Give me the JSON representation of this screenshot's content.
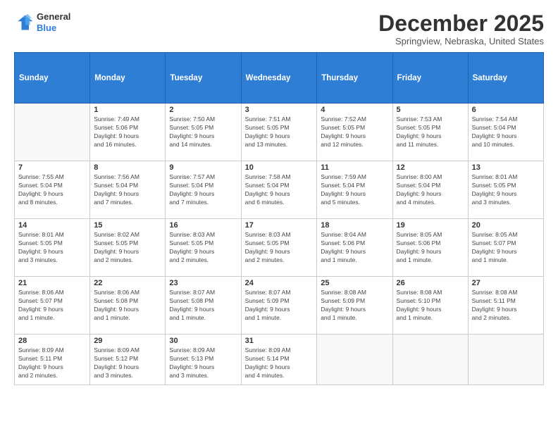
{
  "logo": {
    "line1": "General",
    "line2": "Blue"
  },
  "title": "December 2025",
  "subtitle": "Springview, Nebraska, United States",
  "days_of_week": [
    "Sunday",
    "Monday",
    "Tuesday",
    "Wednesday",
    "Thursday",
    "Friday",
    "Saturday"
  ],
  "weeks": [
    [
      {
        "day": "",
        "info": ""
      },
      {
        "day": "1",
        "info": "Sunrise: 7:49 AM\nSunset: 5:06 PM\nDaylight: 9 hours\nand 16 minutes."
      },
      {
        "day": "2",
        "info": "Sunrise: 7:50 AM\nSunset: 5:05 PM\nDaylight: 9 hours\nand 14 minutes."
      },
      {
        "day": "3",
        "info": "Sunrise: 7:51 AM\nSunset: 5:05 PM\nDaylight: 9 hours\nand 13 minutes."
      },
      {
        "day": "4",
        "info": "Sunrise: 7:52 AM\nSunset: 5:05 PM\nDaylight: 9 hours\nand 12 minutes."
      },
      {
        "day": "5",
        "info": "Sunrise: 7:53 AM\nSunset: 5:05 PM\nDaylight: 9 hours\nand 11 minutes."
      },
      {
        "day": "6",
        "info": "Sunrise: 7:54 AM\nSunset: 5:04 PM\nDaylight: 9 hours\nand 10 minutes."
      }
    ],
    [
      {
        "day": "7",
        "info": "Sunrise: 7:55 AM\nSunset: 5:04 PM\nDaylight: 9 hours\nand 8 minutes."
      },
      {
        "day": "8",
        "info": "Sunrise: 7:56 AM\nSunset: 5:04 PM\nDaylight: 9 hours\nand 7 minutes."
      },
      {
        "day": "9",
        "info": "Sunrise: 7:57 AM\nSunset: 5:04 PM\nDaylight: 9 hours\nand 7 minutes."
      },
      {
        "day": "10",
        "info": "Sunrise: 7:58 AM\nSunset: 5:04 PM\nDaylight: 9 hours\nand 6 minutes."
      },
      {
        "day": "11",
        "info": "Sunrise: 7:59 AM\nSunset: 5:04 PM\nDaylight: 9 hours\nand 5 minutes."
      },
      {
        "day": "12",
        "info": "Sunrise: 8:00 AM\nSunset: 5:04 PM\nDaylight: 9 hours\nand 4 minutes."
      },
      {
        "day": "13",
        "info": "Sunrise: 8:01 AM\nSunset: 5:05 PM\nDaylight: 9 hours\nand 3 minutes."
      }
    ],
    [
      {
        "day": "14",
        "info": "Sunrise: 8:01 AM\nSunset: 5:05 PM\nDaylight: 9 hours\nand 3 minutes."
      },
      {
        "day": "15",
        "info": "Sunrise: 8:02 AM\nSunset: 5:05 PM\nDaylight: 9 hours\nand 2 minutes."
      },
      {
        "day": "16",
        "info": "Sunrise: 8:03 AM\nSunset: 5:05 PM\nDaylight: 9 hours\nand 2 minutes."
      },
      {
        "day": "17",
        "info": "Sunrise: 8:03 AM\nSunset: 5:05 PM\nDaylight: 9 hours\nand 2 minutes."
      },
      {
        "day": "18",
        "info": "Sunrise: 8:04 AM\nSunset: 5:06 PM\nDaylight: 9 hours\nand 1 minute."
      },
      {
        "day": "19",
        "info": "Sunrise: 8:05 AM\nSunset: 5:06 PM\nDaylight: 9 hours\nand 1 minute."
      },
      {
        "day": "20",
        "info": "Sunrise: 8:05 AM\nSunset: 5:07 PM\nDaylight: 9 hours\nand 1 minute."
      }
    ],
    [
      {
        "day": "21",
        "info": "Sunrise: 8:06 AM\nSunset: 5:07 PM\nDaylight: 9 hours\nand 1 minute."
      },
      {
        "day": "22",
        "info": "Sunrise: 8:06 AM\nSunset: 5:08 PM\nDaylight: 9 hours\nand 1 minute."
      },
      {
        "day": "23",
        "info": "Sunrise: 8:07 AM\nSunset: 5:08 PM\nDaylight: 9 hours\nand 1 minute."
      },
      {
        "day": "24",
        "info": "Sunrise: 8:07 AM\nSunset: 5:09 PM\nDaylight: 9 hours\nand 1 minute."
      },
      {
        "day": "25",
        "info": "Sunrise: 8:08 AM\nSunset: 5:09 PM\nDaylight: 9 hours\nand 1 minute."
      },
      {
        "day": "26",
        "info": "Sunrise: 8:08 AM\nSunset: 5:10 PM\nDaylight: 9 hours\nand 1 minute."
      },
      {
        "day": "27",
        "info": "Sunrise: 8:08 AM\nSunset: 5:11 PM\nDaylight: 9 hours\nand 2 minutes."
      }
    ],
    [
      {
        "day": "28",
        "info": "Sunrise: 8:09 AM\nSunset: 5:11 PM\nDaylight: 9 hours\nand 2 minutes."
      },
      {
        "day": "29",
        "info": "Sunrise: 8:09 AM\nSunset: 5:12 PM\nDaylight: 9 hours\nand 3 minutes."
      },
      {
        "day": "30",
        "info": "Sunrise: 8:09 AM\nSunset: 5:13 PM\nDaylight: 9 hours\nand 3 minutes."
      },
      {
        "day": "31",
        "info": "Sunrise: 8:09 AM\nSunset: 5:14 PM\nDaylight: 9 hours\nand 4 minutes."
      },
      {
        "day": "",
        "info": ""
      },
      {
        "day": "",
        "info": ""
      },
      {
        "day": "",
        "info": ""
      }
    ]
  ]
}
